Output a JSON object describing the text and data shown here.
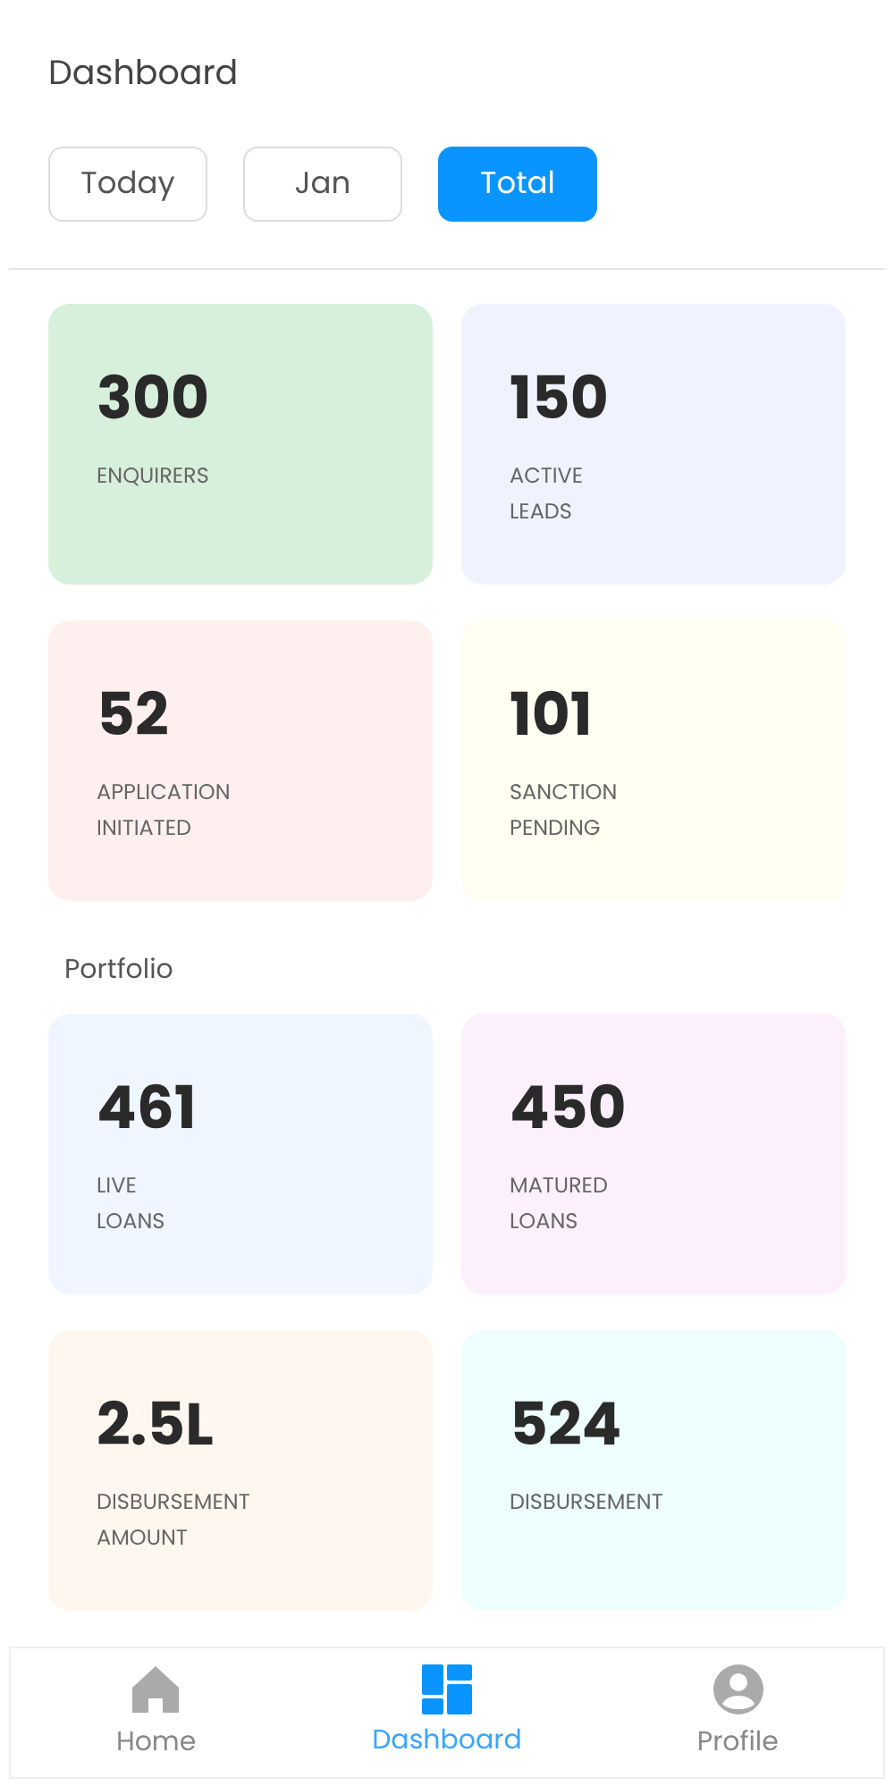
{
  "title": "Dashboard",
  "tabs": [
    {
      "label": "Today",
      "selected": false
    },
    {
      "label": "Jan",
      "selected": false
    },
    {
      "label": "Total",
      "selected": true
    }
  ],
  "sections": [
    {
      "cards": [
        {
          "value": "300",
          "label": "ENQUIRERS",
          "color": "#d7f0dc"
        },
        {
          "value": "150",
          "label": "ACTIVE\nLEADS",
          "color": "#f0f3ff"
        },
        {
          "value": "52",
          "label": "APPLICATION\nINITIATED",
          "color": "#fff0ef"
        },
        {
          "value": "101",
          "label": "SANCTION\nPENDING",
          "color": "#fffef0"
        }
      ]
    },
    {
      "heading": "Portfolio",
      "cards": [
        {
          "value": "461",
          "label": "LIVE\nLOANS",
          "color": "#eff6ff"
        },
        {
          "value": "450",
          "label": "MATURED\nLOANS",
          "color": "#fcf0fd"
        },
        {
          "value": "2.5L",
          "label": "DISBURSEMENT\nAMOUNT",
          "color": "#fff7ef"
        },
        {
          "value": "524",
          "label": "DISBURSEMENT",
          "color": "#eefdfe"
        }
      ]
    }
  ],
  "nav": [
    {
      "kind": "home",
      "label": "Home",
      "selected": false
    },
    {
      "kind": "dashboard",
      "label": "Dashboard",
      "selected": true
    },
    {
      "kind": "profile",
      "label": "Profile",
      "selected": false
    }
  ]
}
